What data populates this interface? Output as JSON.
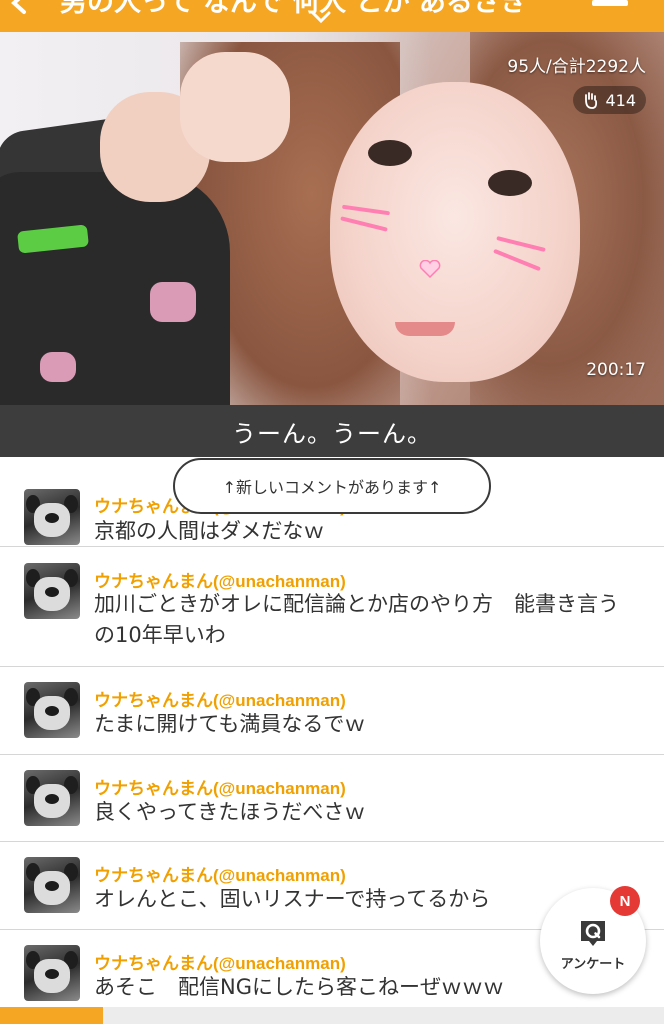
{
  "header": {
    "title": "男の人って なんで 何人 とか あるさき"
  },
  "video": {
    "viewers": "95人/合計2292人",
    "claps": "414",
    "elapsed": "200:17"
  },
  "caption": "うーん。うーん。",
  "new_comment_notice": "↑新しいコメントがあります↑",
  "comments": [
    {
      "user": "ウナちゃんまん(@unachanman)",
      "text": "京都の人間はダメだなｗ"
    },
    {
      "user": "ウナちゃんまん(@unachanman)",
      "text": "加川ごときがオレに配信論とか店のやり方　能書き言うの10年早いわ"
    },
    {
      "user": "ウナちゃんまん(@unachanman)",
      "text": "たまに開けても満員なるでｗ"
    },
    {
      "user": "ウナちゃんまん(@unachanman)",
      "text": "良くやってきたほうだべさｗ"
    },
    {
      "user": "ウナちゃんまん(@unachanman)",
      "text": "オレんとこ、固いリスナーで持ってるから"
    },
    {
      "user": "ウナちゃんまん(@unachanman)",
      "text": "あそこ　配信NGにしたら客こねーぜｗｗｗ"
    }
  ],
  "survey": {
    "label": "アンケート",
    "badge": "N"
  },
  "bottom_progress": 0.155,
  "colors": {
    "accent": "#f5a623",
    "username": "#f0a000",
    "badge": "#e53935"
  }
}
